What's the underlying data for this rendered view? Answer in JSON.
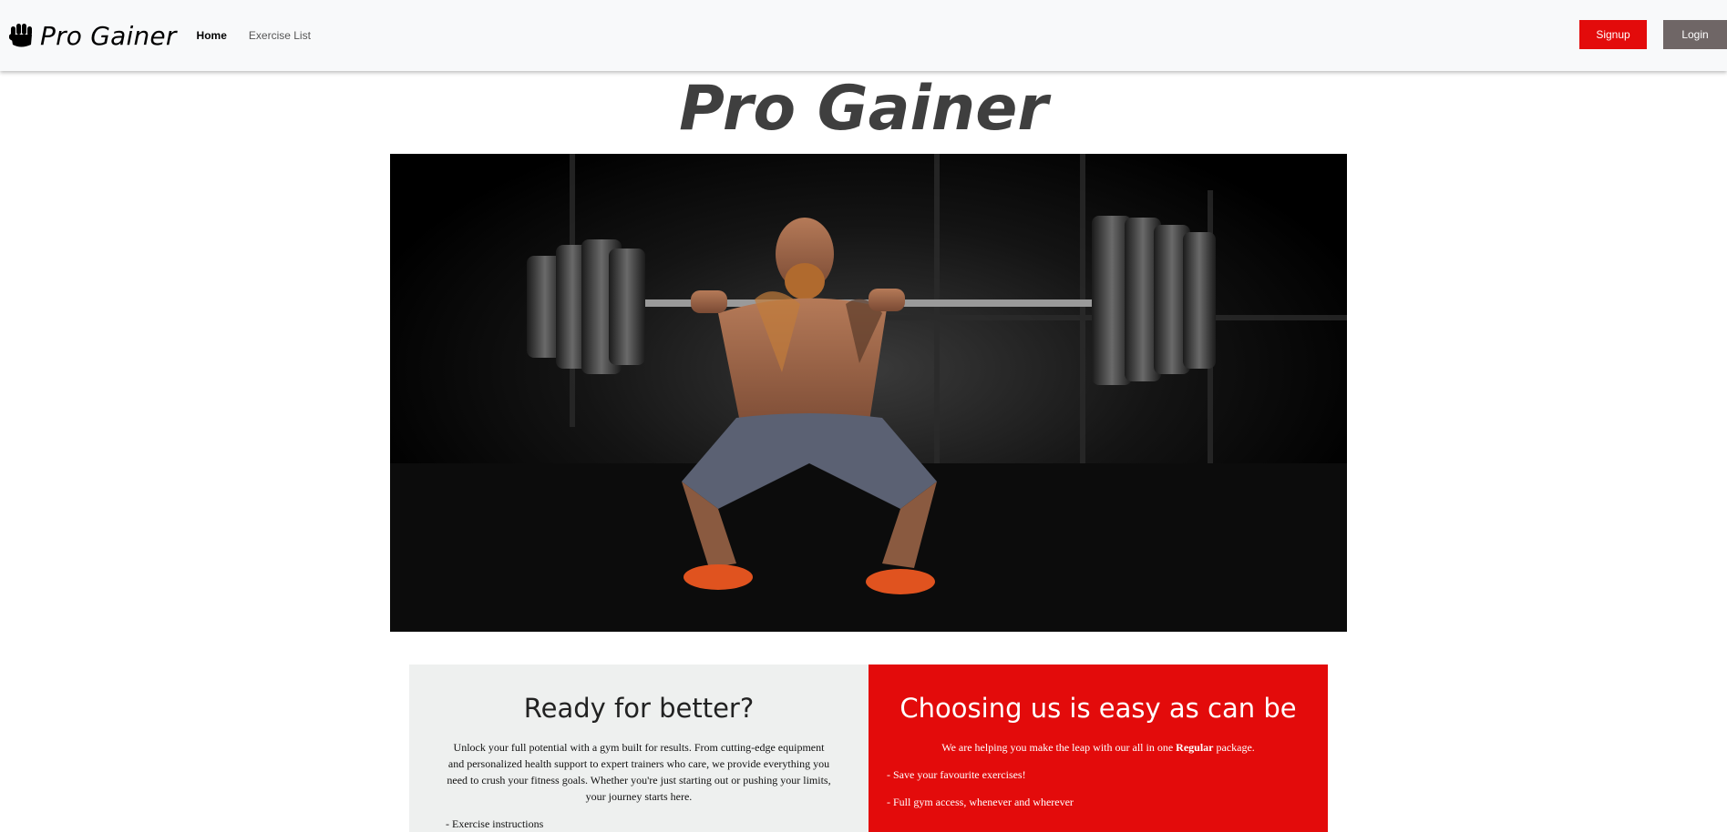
{
  "nav": {
    "brand": "Pro Gainer",
    "links": [
      {
        "label": "Home",
        "active": true
      },
      {
        "label": "Exercise List",
        "active": false
      }
    ],
    "signup_label": "Signup",
    "login_label": "Login"
  },
  "hero": {
    "title": "Pro Gainer",
    "image_alt": "athlete squatting a heavy barbell in a dark gym"
  },
  "panels": {
    "left": {
      "heading": "Ready for better?",
      "text": "Unlock your full potential with a gym built for results. From cutting-edge equipment and personalized health support to expert trainers who care, we provide everything you need to crush your fitness goals. Whether you're just starting out or pushing your limits, your journey starts here.",
      "list": [
        "- Exercise instructions"
      ]
    },
    "right": {
      "heading": "Choosing us is easy as can be",
      "text_before": "We are helping you make the leap with our all in one ",
      "text_bold": "Regular",
      "text_after": " package.",
      "list": [
        "- Save your favourite exercises!",
        "- Full gym access, whenever and wherever"
      ]
    }
  },
  "colors": {
    "accent": "#e30b0b",
    "login": "#6f6666",
    "navbar": "#f8f9fa",
    "panel_left": "#eef0ef"
  }
}
